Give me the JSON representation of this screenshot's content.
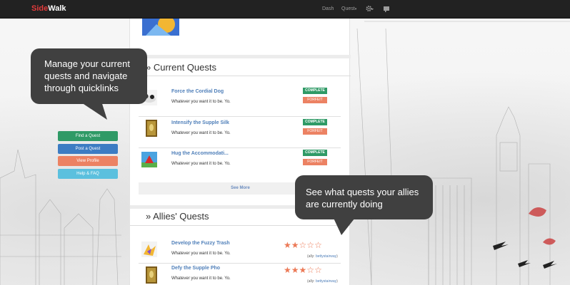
{
  "navbar": {
    "brand_part1": "Side",
    "brand_part2": "Walk",
    "dash": "Dash",
    "quest": "Quest",
    "caret": "▾",
    "settings_icon": "gear-icon",
    "notifications_icon": "flag-icon"
  },
  "sections": {
    "current_title": "» Current Quests",
    "allies_title": "» Allies' Quests"
  },
  "current_quests": [
    {
      "title": "Force the Cordial Dog",
      "desc": "Whatever you want it to be. Yo.",
      "complete": "COMPLETE",
      "forfeit": "FORFEIT"
    },
    {
      "title": "Intensify the Supple Silk",
      "desc": "Whatever you want it to be. Yo.",
      "complete": "COMPLETE",
      "forfeit": "FORFEIT"
    },
    {
      "title": "Hug the Accommodati...",
      "desc": "Whatever you want it to be. Yo.",
      "complete": "COMPLETE",
      "forfeit": "FORFEIT"
    }
  ],
  "see_more": "See More",
  "allies_quests": [
    {
      "title": "Develop the Fuzzy Trash",
      "desc": "Whatever you want it to be. Yo.",
      "rating": 2,
      "max_rating": 5,
      "ally_label": "(ally:",
      "ally_name": "bettystairway",
      "ally_close": ")"
    },
    {
      "title": "Defy the Supple Pho",
      "desc": "Whatever you want it to be. Yo.",
      "rating": 3,
      "max_rating": 5,
      "ally_label": "(ally:",
      "ally_name": "bettystairway",
      "ally_close": ")"
    }
  ],
  "side_menu": {
    "find": "Find a Quest",
    "post": "Post a Quest",
    "profile": "View Profile",
    "help": "Help & FAQ",
    "colors": {
      "find": "#2f9a66",
      "post": "#3c7cc3",
      "profile": "#ec8263",
      "help": "#5bc0de"
    }
  },
  "callouts": {
    "left": "Manage your current quests and navigate through quicklinks",
    "right": "See what quests your allies are currently doing"
  },
  "colors": {
    "navbar": "#222222",
    "brand_accent": "#e23b3b",
    "link": "#4f7fb9",
    "complete": "#2f9a66",
    "forfeit": "#ec8263",
    "star": "#ec7a57",
    "callout": "#404040"
  }
}
